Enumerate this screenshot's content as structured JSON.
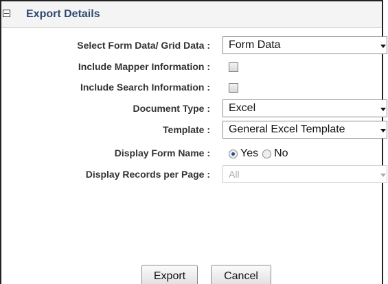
{
  "section": {
    "title": "Export Details"
  },
  "fields": {
    "form_grid": {
      "label": "Select Form Data/ Grid Data :",
      "value": "Form Data"
    },
    "mapper_info": {
      "label": "Include Mapper Information :",
      "checked": false
    },
    "search_info": {
      "label": "Include Search Information :",
      "checked": false
    },
    "document_type": {
      "label": "Document Type :",
      "value": "Excel"
    },
    "template": {
      "label": "Template :",
      "value": "General Excel Template"
    },
    "display_form_name": {
      "label": "Display Form Name :",
      "options": [
        "Yes",
        "No"
      ],
      "selected": "Yes"
    },
    "records_per_page": {
      "label": "Display Records per Page :",
      "value": "All",
      "disabled": true
    }
  },
  "buttons": {
    "export": "Export",
    "cancel": "Cancel"
  },
  "icons": {
    "collapse": "collapse-minus-icon",
    "dropdown": "chevron-down-icon"
  },
  "colors": {
    "header_text": "#2e4a6f",
    "label_text": "#333333",
    "radio_selected": "#1a4f8c"
  }
}
